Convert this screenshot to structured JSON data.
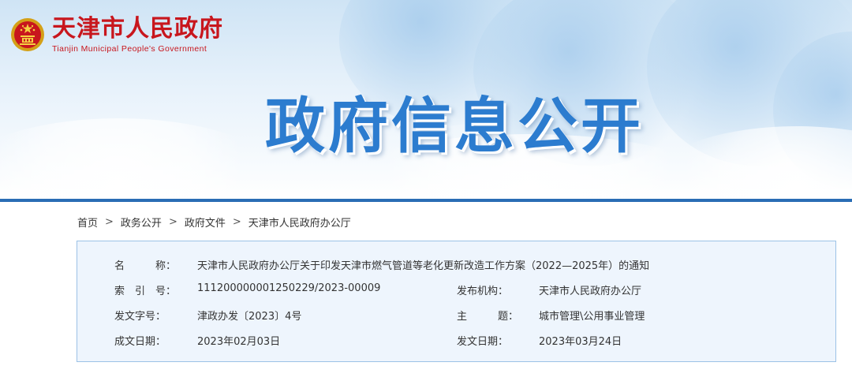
{
  "header": {
    "site_name": "天津市人民政府",
    "site_name_en": "Tianjin Municipal People's Government",
    "banner_title": "政府信息公开"
  },
  "breadcrumb": {
    "items": [
      "首页",
      "政务公开",
      "政府文件",
      "天津市人民政府办公厅"
    ],
    "separator": ">"
  },
  "info": {
    "name": {
      "label": "名　　　称：",
      "value": "天津市人民政府办公厅关于印发天津市燃气管道等老化更新改造工作方案（2022—2025年）的通知"
    },
    "index_no": {
      "label": "索　引　号：",
      "value": "11120000000125022​9/2023-00009"
    },
    "issuer": {
      "label": "发布机构：",
      "value": "天津市人民政府办公厅"
    },
    "doc_no": {
      "label": "发文字号：",
      "value": "津政办发〔2023〕4号"
    },
    "subject": {
      "label": "主　　　题：",
      "value": "城市管理\\公用事业管理"
    },
    "created_date": {
      "label": "成文日期：",
      "value": "2023年02月03日"
    },
    "publish_date": {
      "label": "发文日期：",
      "value": "2023年03月24日"
    }
  },
  "colors": {
    "brand_red": "#c8161d",
    "title_blue": "#2c7ccf",
    "panel_bg": "#eef5fd",
    "panel_border": "#9cc2e6"
  }
}
